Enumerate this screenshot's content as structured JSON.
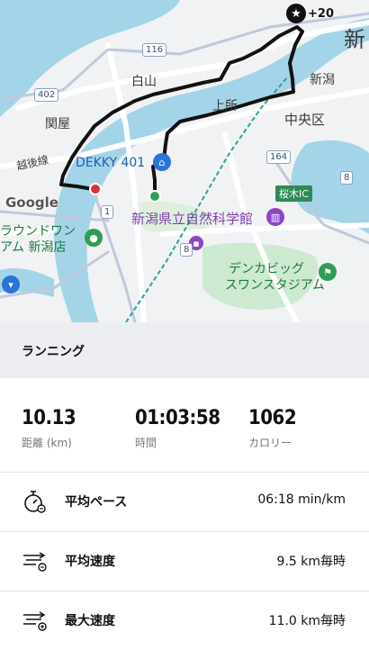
{
  "map": {
    "labels": {
      "hakusan": "白山",
      "sekiya": "関屋",
      "koshikawa": "越後線",
      "dekky": "DEKKY 401",
      "kamitokoro": "上所",
      "niigata_station": "新潟",
      "niigata_top": "新",
      "chuo_ku": "中央区",
      "sakuragi_ic": "桜木IC",
      "museum": "新潟県立自然科学館",
      "round_one_1": "ラウンドワン",
      "round_one_2": "アム 新潟店",
      "denka_1": "デンカビッグ",
      "denka_2": "スワンスタジアム",
      "google": "Google"
    },
    "shields": {
      "r116": "116",
      "r402": "402",
      "r164": "164",
      "r8a": "8",
      "r8b": "8",
      "r1": "1"
    },
    "badge": {
      "icon": "star-icon",
      "text": "+20"
    },
    "colors": {
      "water": "#a3d4e8",
      "route": "#111111",
      "rail": "#2aa39a",
      "park": "#cde9d0"
    }
  },
  "section": {
    "title": "ランニング"
  },
  "stats": [
    {
      "value": "10.13",
      "label": "距離 (km)"
    },
    {
      "value": "01:03:58",
      "label": "時間"
    },
    {
      "value": "1062",
      "label": "カロリー"
    }
  ],
  "metrics": [
    {
      "icon": "stopwatch-icon",
      "name": "平均ペース",
      "value": "06:18 min/km"
    },
    {
      "icon": "average-speed-icon",
      "name": "平均速度",
      "value": "9.5 km毎時"
    },
    {
      "icon": "max-speed-icon",
      "name": "最大速度",
      "value": "11.0 km毎時"
    }
  ]
}
